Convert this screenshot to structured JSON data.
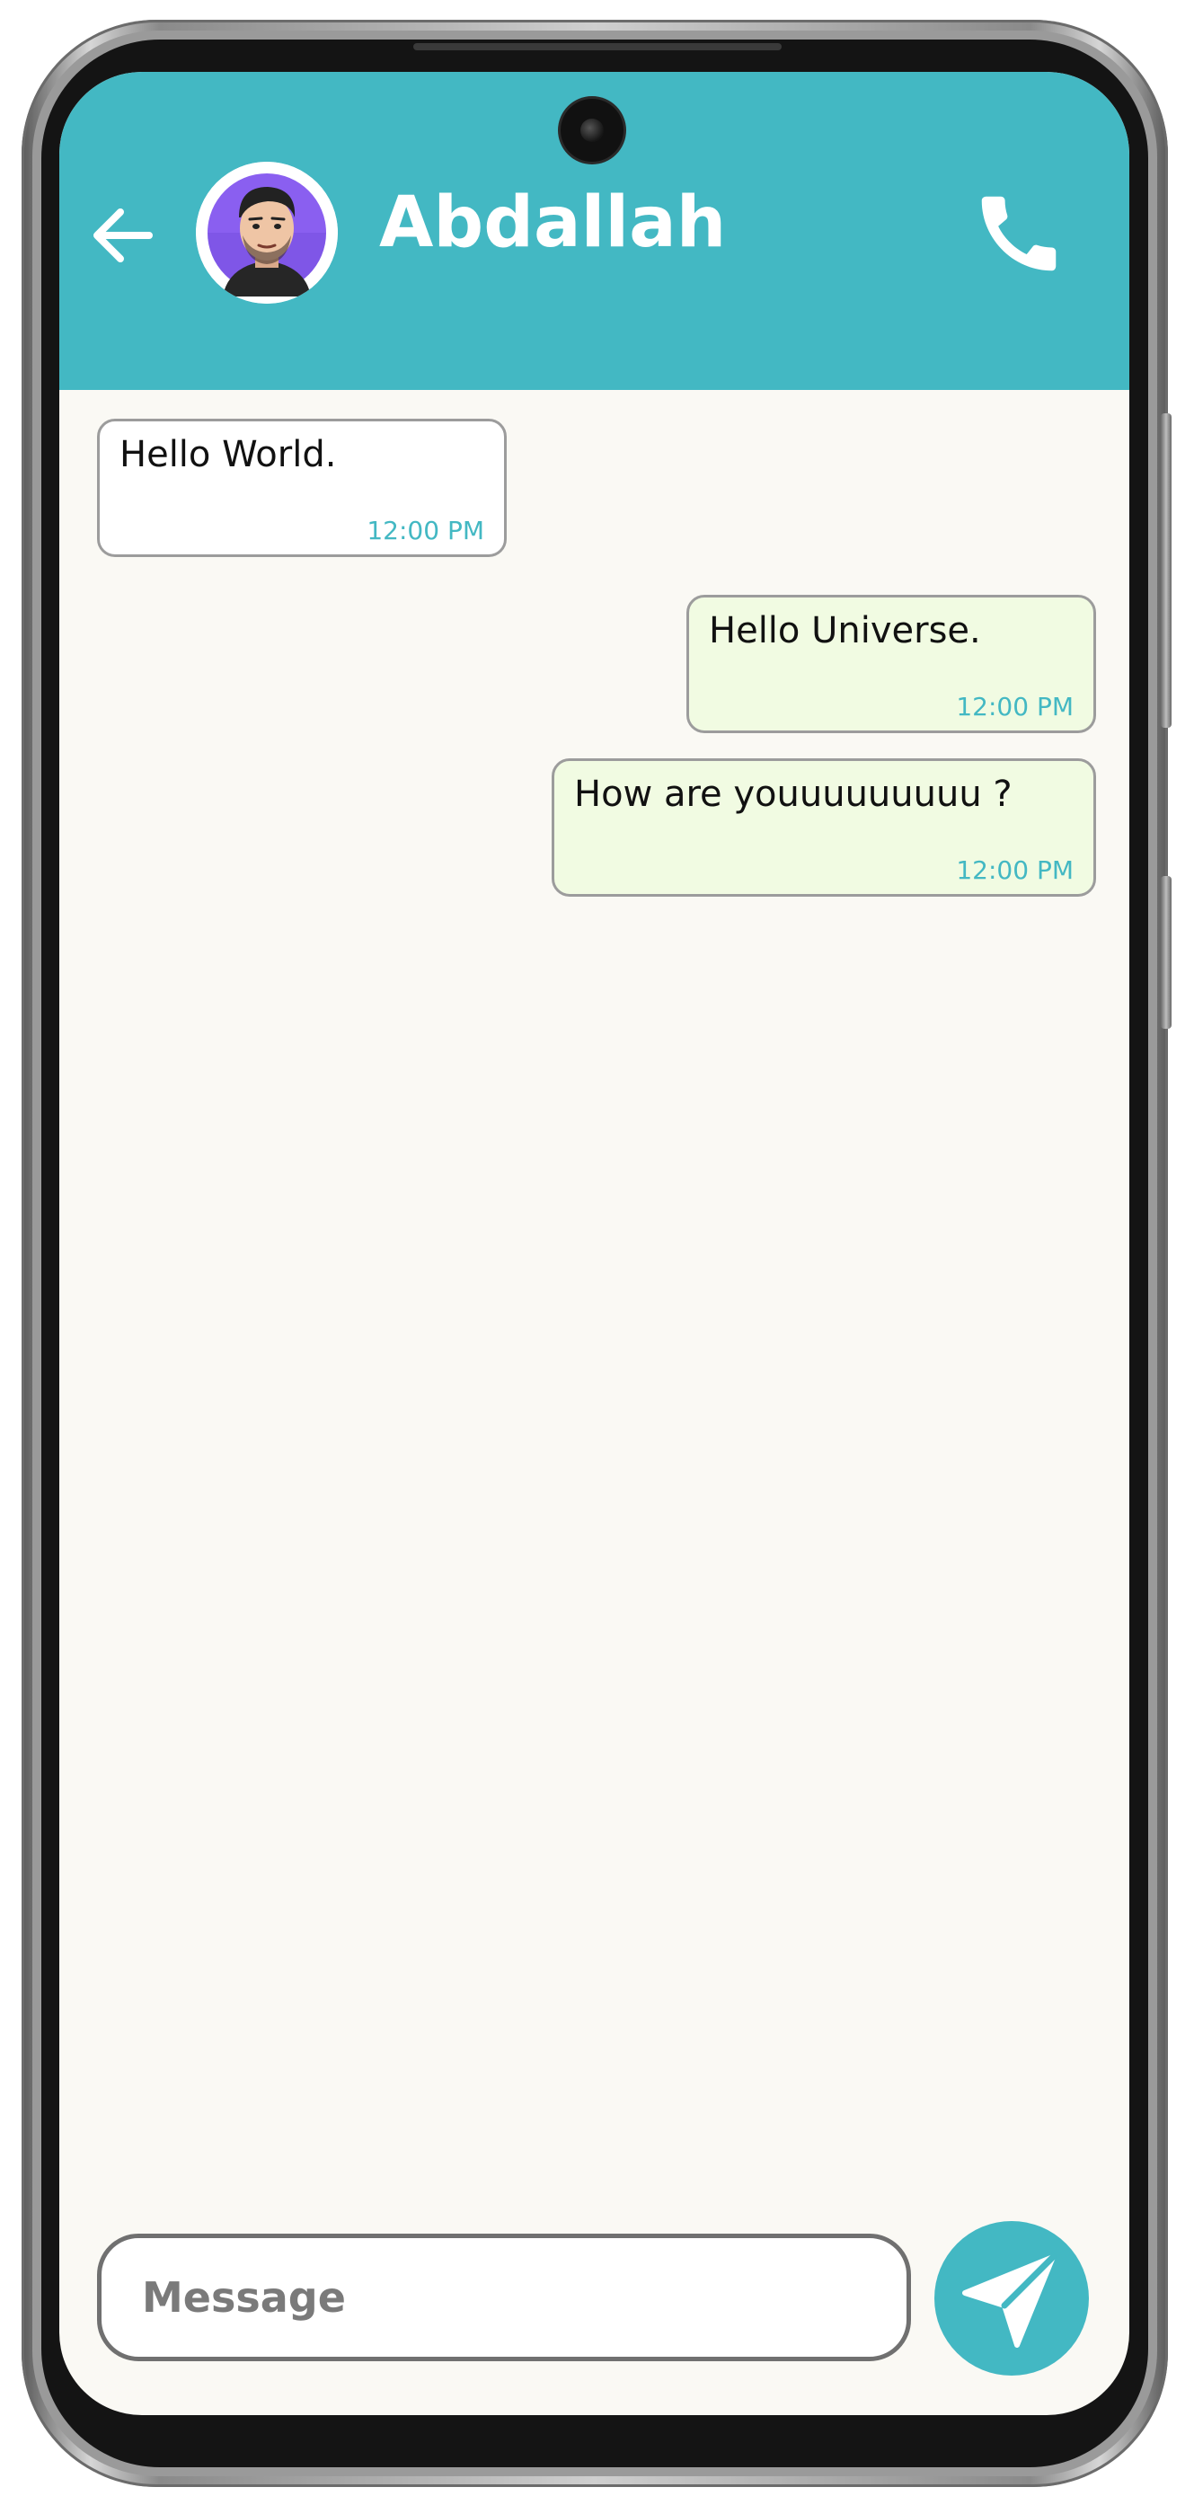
{
  "app": {
    "accent_color": "#43b8c3",
    "background_color": "#faf9f4"
  },
  "header": {
    "back_icon": "arrow-left-icon",
    "contact_name": "Abdallah",
    "avatar": "cartoon-man-avatar",
    "call_icon": "phone-icon"
  },
  "messages": [
    {
      "direction": "incoming",
      "text": "Hello World.",
      "time": "12:00 PM",
      "bubble_color": "#ffffff"
    },
    {
      "direction": "outgoing",
      "text": "Hello Universe.",
      "time": "12:00 PM",
      "bubble_color": "#f1fbe2"
    },
    {
      "direction": "outgoing",
      "text": "How are youuuuuuuuu ?",
      "time": "12:00 PM",
      "bubble_color": "#f1fbe2"
    }
  ],
  "composer": {
    "input_placeholder": "Message",
    "input_value": "",
    "send_icon": "send-icon"
  }
}
